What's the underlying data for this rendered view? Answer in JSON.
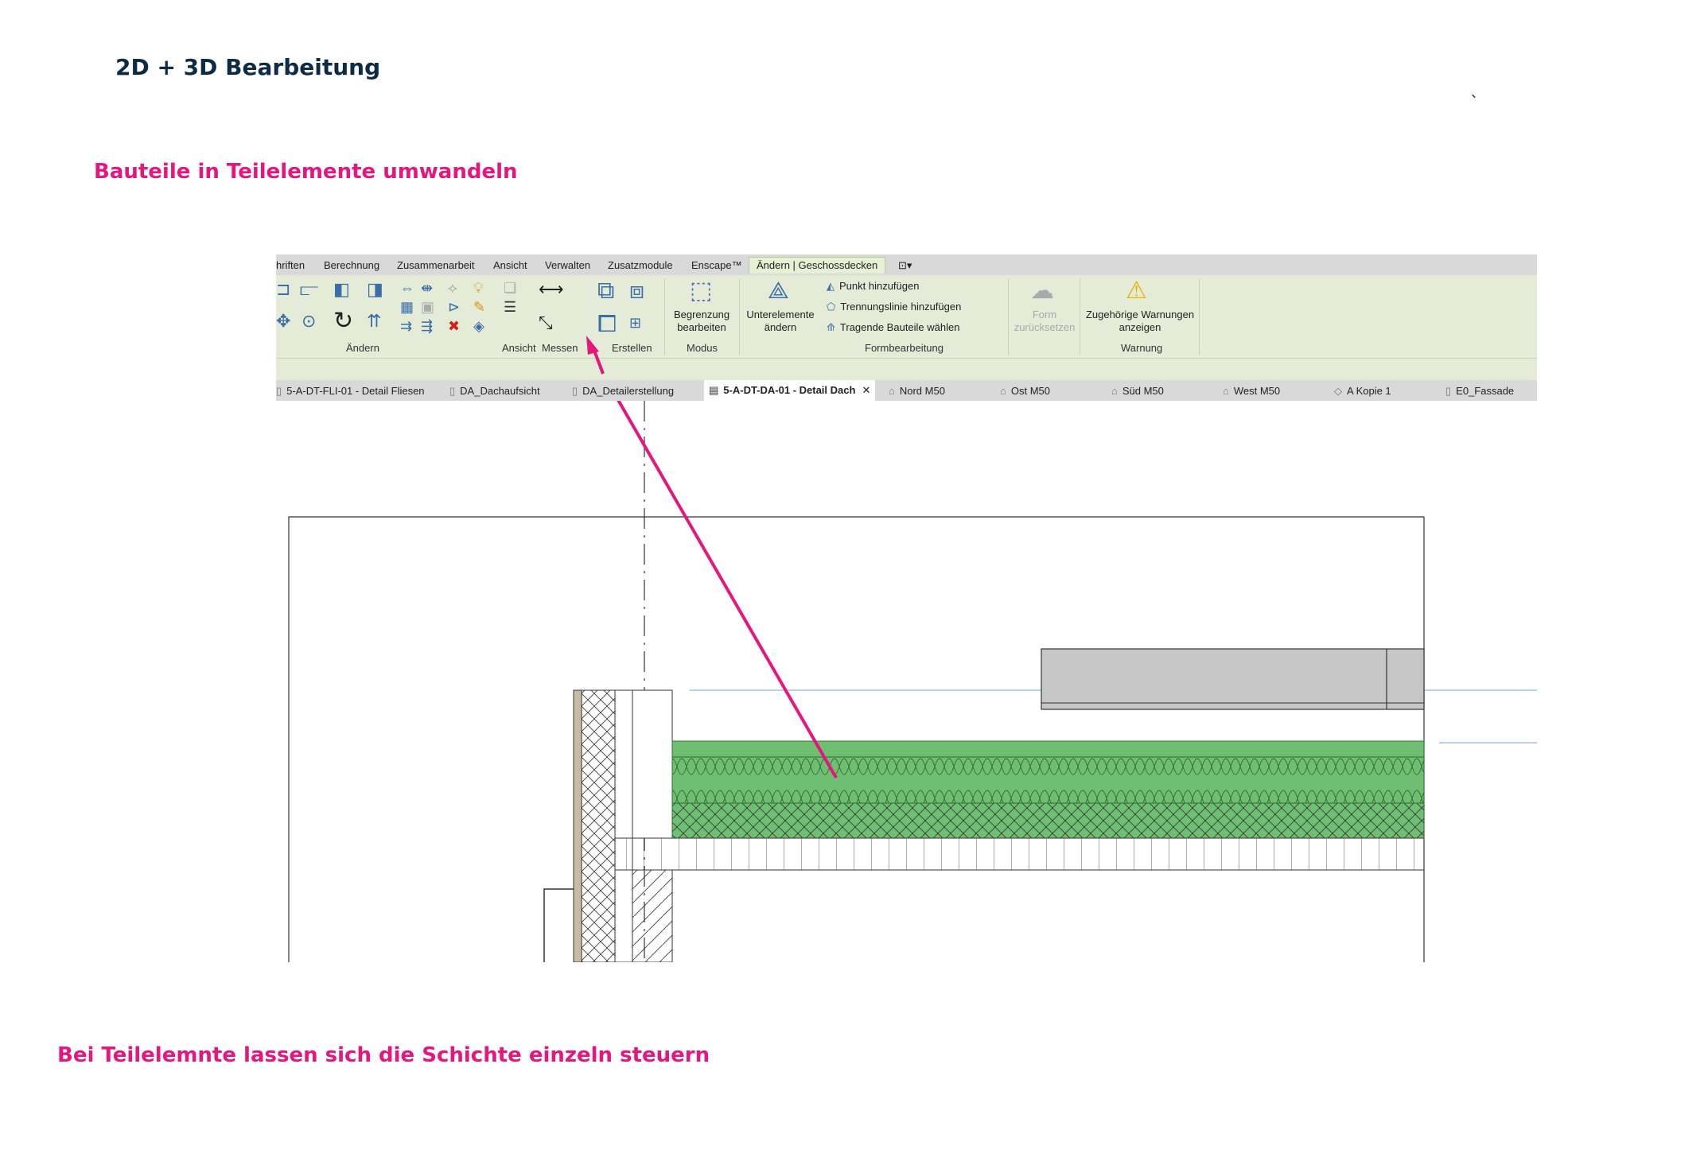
{
  "page": {
    "title": "2D + 3D Bearbeitung",
    "subtitle1": "Bauteile in Teilelemente umwandeln",
    "subtitle2": "Bei Teilelemnte lassen sich die Schichte einzeln steuern",
    "tick_mark": "`"
  },
  "colors": {
    "heading": "#0d2b45",
    "accent": "#e5177e",
    "ribbon_bg": "#e4ecd8",
    "insulation_green": "#6fbf73"
  },
  "menu": {
    "items": [
      "hriften",
      "Berechnung",
      "Zusammenarbeit",
      "Ansicht",
      "Verwalten",
      "Zusatzmodule",
      "Enscape™"
    ],
    "active": "Ändern | Geschossdecken",
    "extra": "⊡▾"
  },
  "ribbon": {
    "panels": {
      "aendern": "Ändern",
      "ansicht": "Ansicht",
      "messen": "Messen",
      "erstellen": "Erstellen",
      "modus": "Modus",
      "formbearbeitung": "Formbearbeitung",
      "warnung": "Warnung"
    },
    "buttons": {
      "begrenzung": [
        "Begrenzung",
        "bearbeiten"
      ],
      "unterelemente": [
        "Unterelemente",
        "ändern"
      ],
      "punkt": "Punkt hinzufügen",
      "trennungslinie": "Trennungslinie hinzufügen",
      "tragende": "Tragende Bauteile wählen",
      "form": [
        "Form",
        "zurücksetzen"
      ],
      "warnungen": [
        "Zugehörige Warnungen",
        "anzeigen"
      ]
    },
    "icons": [
      "move-icon",
      "copy-icon",
      "align-icon",
      "mirror-icon",
      "rotate-icon",
      "trim-icon",
      "offset-icon",
      "array-icon",
      "scale-icon",
      "pin-icon",
      "delete-icon",
      "paint-icon",
      "measure-icon",
      "parts-icon",
      "edit-boundary-icon",
      "modify-subelements-icon",
      "add-point-icon",
      "split-line-icon",
      "pick-supports-icon",
      "reset-shape-icon",
      "warning-icon"
    ]
  },
  "tabs": [
    {
      "label": "5-A-DT-FLI-01 - Detail Fliesen",
      "icon": "sheet-icon"
    },
    {
      "label": "DA_Dachaufsicht",
      "icon": "sheet-icon"
    },
    {
      "label": "DA_Detailerstellung",
      "icon": "sheet-icon"
    },
    {
      "label": "5-A-DT-DA-01 - Detail Dach",
      "icon": "detail-icon",
      "active": true,
      "close": "✕"
    },
    {
      "label": "Nord M50",
      "icon": "elevation-icon"
    },
    {
      "label": "Ost M50",
      "icon": "elevation-icon"
    },
    {
      "label": "Süd  M50",
      "icon": "elevation-icon"
    },
    {
      "label": "West  M50",
      "icon": "elevation-icon"
    },
    {
      "label": "A Kopie 1",
      "icon": "3d-view-icon"
    },
    {
      "label": "E0_Fassade",
      "icon": "sheet-icon"
    }
  ]
}
